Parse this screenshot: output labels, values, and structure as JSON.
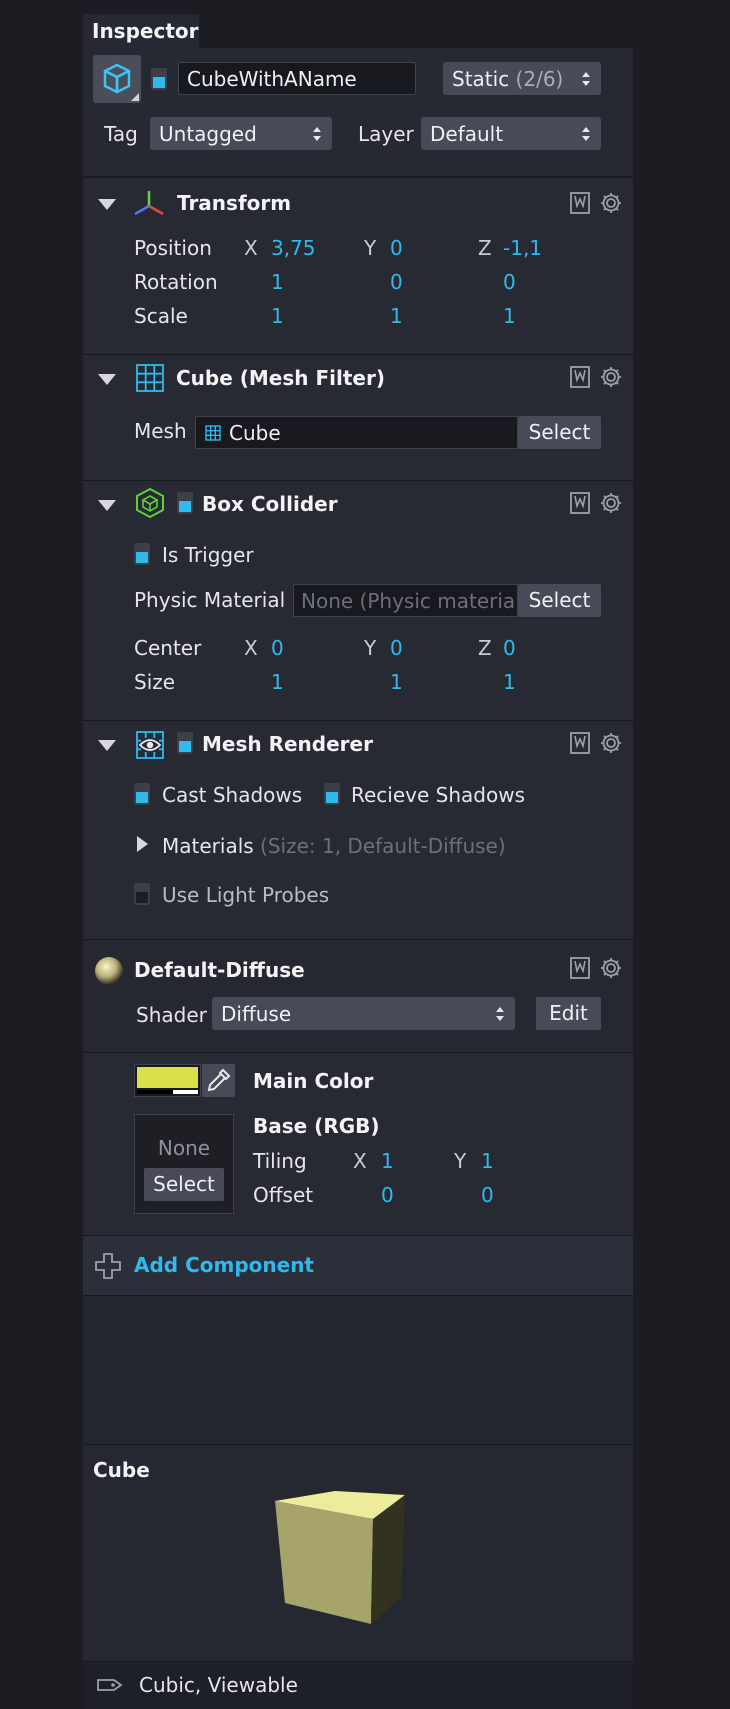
{
  "inspector": {
    "tab_label": "Inspector"
  },
  "object": {
    "name": "CubeWithAName",
    "static_label": "Static",
    "static_count": "(2/6)",
    "tag_label": "Tag",
    "tag_value": "Untagged",
    "layer_label": "Layer",
    "layer_value": "Default"
  },
  "transform": {
    "title": "Transform",
    "rows": [
      {
        "label": "Position",
        "x_axis": "X",
        "x": "3,75",
        "y_axis": "Y",
        "y": "0",
        "z_axis": "Z",
        "z": "-1,1"
      },
      {
        "label": "Rotation",
        "x": "1",
        "y": "0",
        "z": "0"
      },
      {
        "label": "Scale",
        "x": "1",
        "y": "1",
        "z": "1"
      }
    ]
  },
  "mesh_filter": {
    "title": "Cube (Mesh Filter)",
    "mesh_label": "Mesh",
    "mesh_value": "Cube",
    "select_label": "Select"
  },
  "box_collider": {
    "title": "Box Collider",
    "is_trigger_label": "Is Trigger",
    "physic_label": "Physic Material",
    "physic_placeholder": "None (Physic material)",
    "select_label": "Select",
    "rows": [
      {
        "label": "Center",
        "x_axis": "X",
        "x": "0",
        "y_axis": "Y",
        "y": "0",
        "z_axis": "Z",
        "z": "0"
      },
      {
        "label": "Size",
        "x": "1",
        "y": "1",
        "z": "1"
      }
    ]
  },
  "mesh_renderer": {
    "title": "Mesh Renderer",
    "cast_shadows_label": "Cast Shadows",
    "receive_shadows_label": "Recieve Shadows",
    "materials_label": "Materials",
    "materials_info": "(Size: 1, Default-Diffuse)",
    "light_probes_label": "Use Light Probes"
  },
  "material": {
    "title": "Default-Diffuse",
    "shader_label": "Shader",
    "shader_value": "Diffuse",
    "edit_label": "Edit",
    "main_color_label": "Main Color",
    "main_color": "#d8e04a",
    "texture_none": "None",
    "texture_select": "Select",
    "base_label": "Base (RGB)",
    "tiling_label": "Tiling",
    "tiling_x_axis": "X",
    "tiling_x": "1",
    "tiling_y_axis": "Y",
    "tiling_y": "1",
    "offset_label": "Offset",
    "offset_x": "0",
    "offset_y": "0"
  },
  "add_component_label": "Add Component",
  "preview": {
    "title": "Cube",
    "labels": "Cubic,  Viewable"
  },
  "colors": {
    "accent": "#2fb9ee",
    "panel": "#272a33",
    "background": "#1b1d23"
  }
}
